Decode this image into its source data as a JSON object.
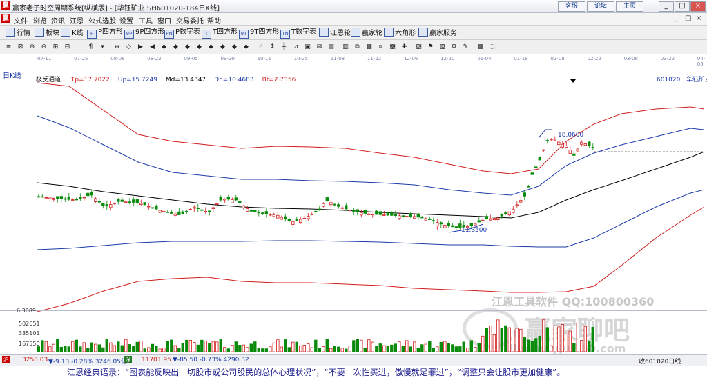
{
  "window": {
    "title": "赢家老子时空周期系统[纵横版] - [华钰矿业  SH601020-184日K线]",
    "top_buttons": [
      "客服",
      "论坛",
      "主页"
    ],
    "controls": [
      "_",
      "□",
      "×"
    ]
  },
  "menu": {
    "items": [
      "文件",
      "浏览",
      "资讯",
      "江恩",
      "公式选股",
      "设置",
      "工具",
      "窗口",
      "交易委托",
      "帮助"
    ],
    "controls": [
      "_",
      "□",
      "×"
    ]
  },
  "toolbar": {
    "items": [
      {
        "label": "行情",
        "icon": "grid-icon"
      },
      {
        "label": "板块",
        "icon": "blocks-icon"
      },
      {
        "label": "K线",
        "icon": "candle-icon"
      },
      {
        "label": "P四方形",
        "icon": "p-square-icon",
        "badge": "P"
      },
      {
        "label": "9P四方形",
        "icon": "9p-square-icon",
        "badge": "9P"
      },
      {
        "label": "P数字表",
        "icon": "p-table-icon",
        "badge": "PN"
      },
      {
        "label": "T四方形",
        "icon": "t-square-icon",
        "badge": "T"
      },
      {
        "label": "9T四方形",
        "icon": "9t-square-icon",
        "badge": "9T"
      },
      {
        "label": "T数字表",
        "icon": "t-table-icon",
        "badge": "TN"
      },
      {
        "label": "江恩轮",
        "icon": "gann-wheel-icon"
      },
      {
        "label": "赢家轮",
        "icon": "winner-wheel-icon"
      },
      {
        "label": "六角形",
        "icon": "hexagon-icon"
      },
      {
        "label": "赢家服务",
        "icon": "service-icon"
      }
    ]
  },
  "drawing_tools": [
    "≡",
    "⊠",
    "⊕",
    "⊖",
    "⊞",
    "⊟",
    "ı",
    "¶",
    "▾",
    "↔",
    "◇",
    "▶",
    "◀",
    "◆",
    "◆",
    "◆",
    "◆",
    "◆",
    "◆",
    "◆",
    "◆",
    "☝",
    "↕",
    "╋",
    "⊿",
    "▣",
    "✉",
    "▤",
    "▥",
    "⧉",
    "▦",
    "⧈",
    "▩",
    "✚",
    "▧",
    "⚑",
    "▨",
    "⚙",
    "✎",
    "▦",
    "⬚"
  ],
  "chart": {
    "period_label": "日K线",
    "indicator": {
      "name": "极反通道",
      "values": [
        {
          "label": "Tp=17.7022",
          "color": "#d21c1c"
        },
        {
          "label": "Up=15.7249",
          "color": "#1c3aa8"
        },
        {
          "label": "Md=13.4347",
          "color": "#000000"
        },
        {
          "label": "Dn=10.4683",
          "color": "#1c3aa8"
        },
        {
          "label": "Bt=7.7356",
          "color": "#d21c1c"
        }
      ]
    },
    "stock_code": "601020",
    "stock_name": "华钰矿业",
    "dates": [
      "07-11",
      "07-25",
      "08-08",
      "08-22",
      "09-05",
      "09-20",
      "10-11",
      "10-25",
      "11-08",
      "11-22",
      "12-06",
      "12-20",
      "01-04",
      "01-18",
      "02-08",
      "02-22",
      "03-08",
      "03-22",
      "04-05"
    ],
    "high_label": "18.0600",
    "low_label": "11.3500",
    "volume_axis": [
      "6.3089",
      "502651",
      "335101",
      "167550"
    ]
  },
  "watermarks": {
    "software": "江恩工具软件  QQ:100800360",
    "forum": "赢家聊吧",
    "url": "liaoba.yjw360.com"
  },
  "status": {
    "sh_index": "3258.03",
    "sh_change": "▼-9.13  -0.28%  3246.05亿",
    "sz_index": "11701.95",
    "sz_change": "▼-85.50  -0.73%  4290.32",
    "right_label": "收601020日线"
  },
  "quote": "江恩经典语录：“图表能反映出一切股市或公司股民的总体心理状况”，“不要一次性买进，傲慢就是罪过”，“调整只会让股市更加健康”。"
}
